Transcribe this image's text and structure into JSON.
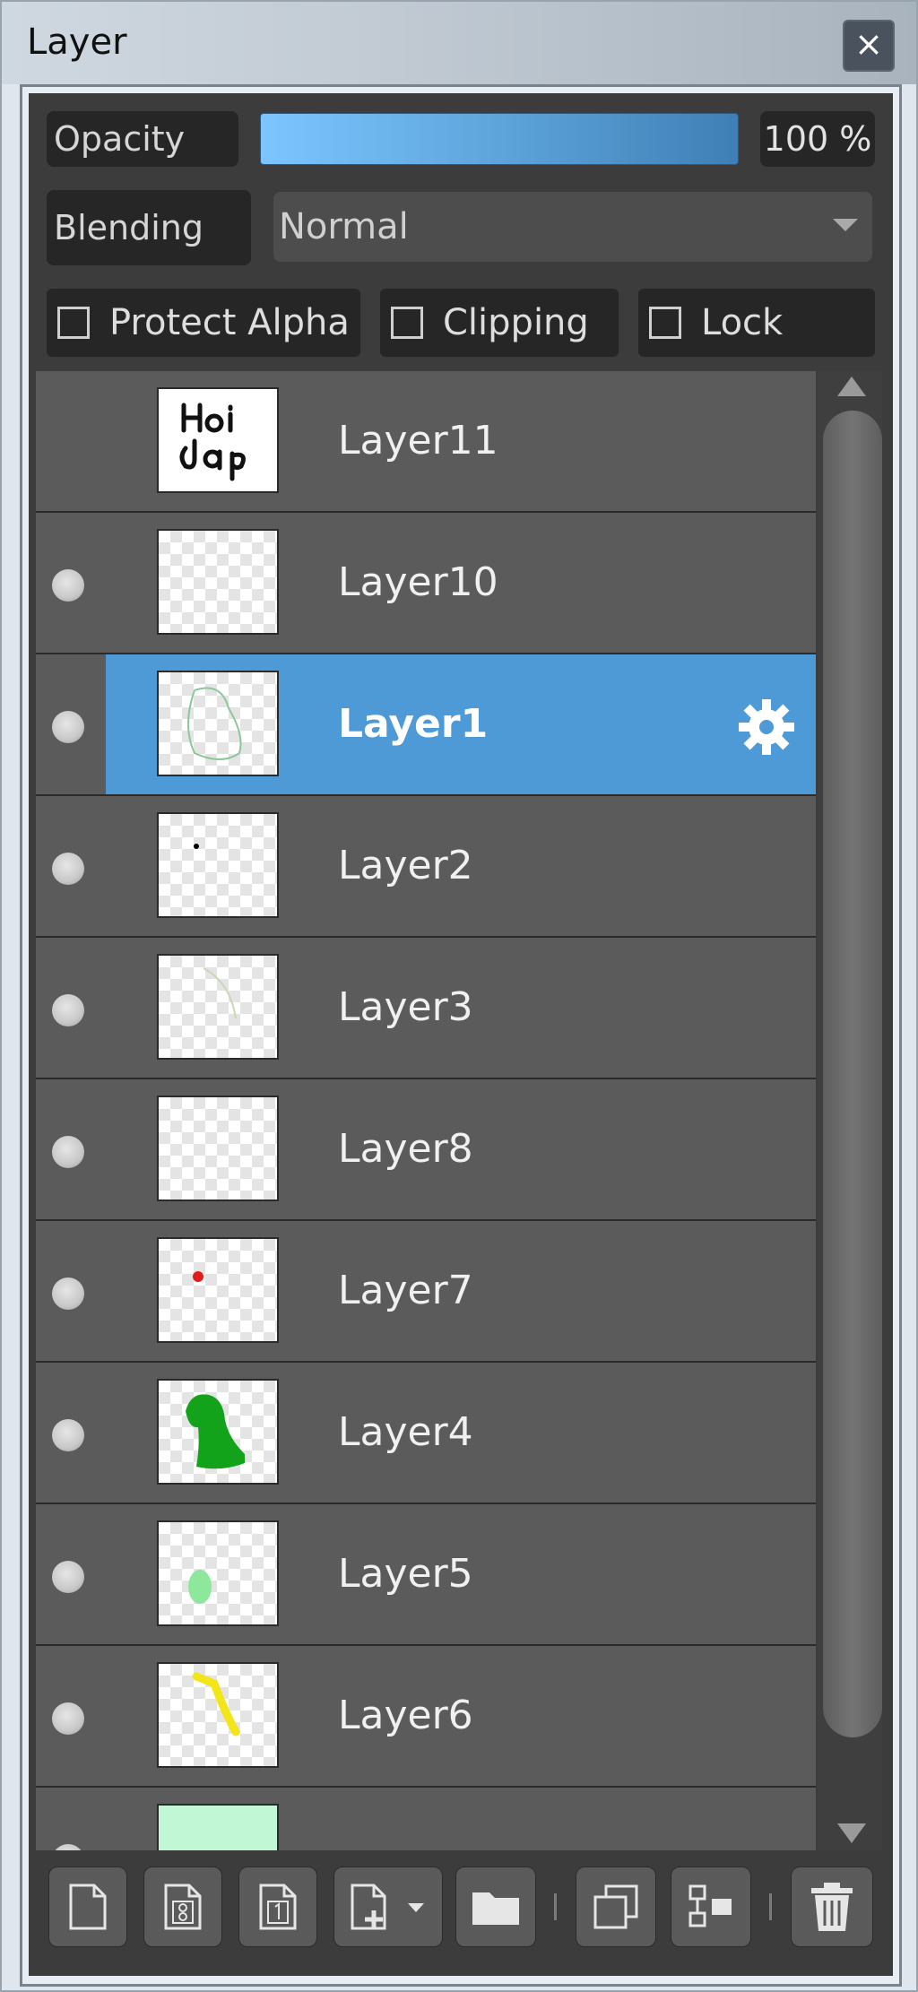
{
  "window": {
    "title": "Layer",
    "close_glyph": "×"
  },
  "controls": {
    "opacity_label": "Opacity",
    "opacity_value": "100 %",
    "opacity_fraction": 1.0,
    "blending_label": "Blending",
    "blending_value": "Normal",
    "protect_alpha_label": "Protect Alpha",
    "clipping_label": "Clipping",
    "lock_label": "Lock",
    "accent_color": "#4e9ad6"
  },
  "layers": [
    {
      "name": "Layer11",
      "visible_dot": false,
      "selected": false,
      "thumb": "text-holdap"
    },
    {
      "name": "Layer10",
      "visible_dot": true,
      "selected": false,
      "thumb": "empty"
    },
    {
      "name": "Layer1",
      "visible_dot": true,
      "selected": true,
      "thumb": "green-outline",
      "settings_icon": "gear-icon"
    },
    {
      "name": "Layer2",
      "visible_dot": true,
      "selected": false,
      "thumb": "black-dot"
    },
    {
      "name": "Layer3",
      "visible_dot": true,
      "selected": false,
      "thumb": "faint-stroke"
    },
    {
      "name": "Layer8",
      "visible_dot": true,
      "selected": false,
      "thumb": "empty"
    },
    {
      "name": "Layer7",
      "visible_dot": true,
      "selected": false,
      "thumb": "red-dot"
    },
    {
      "name": "Layer4",
      "visible_dot": true,
      "selected": false,
      "thumb": "green-shape"
    },
    {
      "name": "Layer5",
      "visible_dot": true,
      "selected": false,
      "thumb": "light-green-blob"
    },
    {
      "name": "Layer6",
      "visible_dot": true,
      "selected": false,
      "thumb": "yellow-stroke"
    },
    {
      "name": "",
      "visible_dot": true,
      "selected": false,
      "thumb": "mint-fill"
    }
  ],
  "toolbar": {
    "buttons": [
      "new-layer-icon",
      "new-8bit-layer-icon",
      "new-1bit-layer-icon",
      "add-layer-dropdown-icon",
      "folder-icon",
      "duplicate-layer-icon",
      "merge-down-icon",
      "delete-layer-icon"
    ]
  }
}
